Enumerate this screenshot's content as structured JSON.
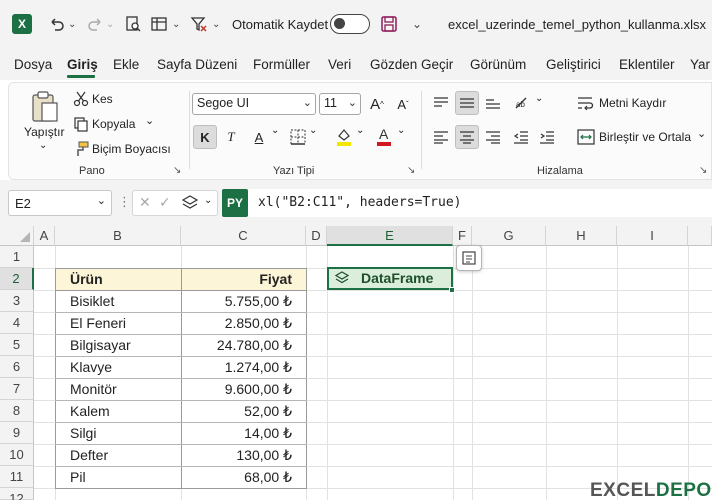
{
  "titlebar": {
    "autosave_label": "Otomatik Kaydet",
    "filename": "excel_uzerinde_temel_python_kullanma.xlsx"
  },
  "tabs": [
    "Dosya",
    "Giriş",
    "Ekle",
    "Sayfa Düzeni",
    "Formüller",
    "Veri",
    "Gözden Geçir",
    "Görünüm",
    "Geliştirici",
    "Eklentiler",
    "Yar"
  ],
  "active_tab": "Giriş",
  "ribbon": {
    "pano": {
      "label": "Pano",
      "paste": "Yapıştır",
      "cut": "Kes",
      "copy": "Kopyala",
      "format_painter": "Biçim Boyacısı"
    },
    "font": {
      "label": "Yazı Tipi",
      "font_name": "Segoe UI",
      "font_size": "11",
      "bold": "K",
      "italic": "T",
      "underline": "A"
    },
    "alignment": {
      "label": "Hizalama",
      "wrap_text": "Metni Kaydır",
      "merge_center": "Birleştir ve Ortala"
    }
  },
  "formula_bar": {
    "name_box": "E2",
    "py_label": "PY",
    "formula": "xl(\"B2:C11\", headers=True)"
  },
  "grid": {
    "columns": [
      "A",
      "B",
      "C",
      "D",
      "E",
      "F",
      "G",
      "H",
      "I"
    ],
    "rows": [
      "1",
      "2",
      "3",
      "4",
      "5",
      "6",
      "7",
      "8",
      "9",
      "10",
      "11",
      "12"
    ],
    "table_headers": [
      "Ürün",
      "Fiyat"
    ],
    "table_rows": [
      {
        "product": "Bisiklet",
        "price": "5.755,00 ₺"
      },
      {
        "product": "El Feneri",
        "price": "2.850,00 ₺"
      },
      {
        "product": "Bilgisayar",
        "price": "24.780,00 ₺"
      },
      {
        "product": "Klavye",
        "price": "1.274,00 ₺"
      },
      {
        "product": "Monitör",
        "price": "9.600,00 ₺"
      },
      {
        "product": "Kalem",
        "price": "52,00 ₺"
      },
      {
        "product": "Silgi",
        "price": "14,00 ₺"
      },
      {
        "product": "Defter",
        "price": "130,00 ₺"
      },
      {
        "product": "Pil",
        "price": "68,00 ₺"
      }
    ],
    "dataframe_label": "DataFrame"
  },
  "watermark": {
    "part1": "EXCEL",
    "part2": "DEPO"
  },
  "colors": {
    "accent": "#1d7044",
    "header_fill": "#fdf5d8",
    "dataframe_fill": "#dbeedb"
  }
}
